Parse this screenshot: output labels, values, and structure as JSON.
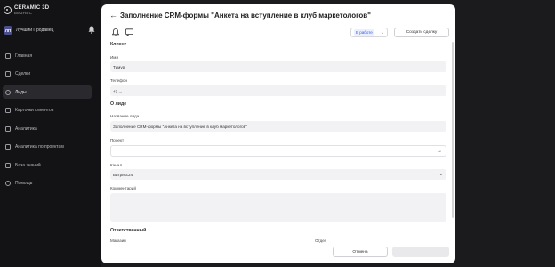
{
  "brand": {
    "name": "CERAMIC 3D",
    "sub": "БИЗНЕС"
  },
  "user": {
    "initials": "ЛП",
    "name": "Лучший Продавец"
  },
  "nav": [
    {
      "label": "Главная",
      "icon": "home-icon"
    },
    {
      "label": "Сделки",
      "icon": "deals-icon"
    },
    {
      "label": "Лиды",
      "icon": "leads-icon",
      "active": true
    },
    {
      "label": "Карточки клиентов",
      "icon": "cards-icon"
    },
    {
      "label": "Аналитика",
      "icon": "analytics-icon"
    },
    {
      "label": "Аналитика по проектам",
      "icon": "project-analytics-icon"
    },
    {
      "label": "База знаний",
      "icon": "book-icon"
    },
    {
      "label": "Помощь",
      "icon": "help-icon"
    }
  ],
  "modal": {
    "title": "Заполнение CRM-формы \"Анкета на вступление в клуб маркетологов\"",
    "status": "В работе",
    "create_deal": "Создать сделку",
    "client_section": "Клиент",
    "name_label": "Имя",
    "name_value": "Тимур",
    "phone_label": "Телефон",
    "phone_value": "+7 ...",
    "lead_section": "О лиде",
    "lead_name_label": "Название лида",
    "lead_name_value": "Заполнение CRM-формы \"Анкета на вступление в клуб маркетологов\"",
    "project_label": "Проект",
    "project_value": "",
    "channel_label": "Канал",
    "channel_value": "Битрикс24",
    "comment_label": "Комментарий",
    "comment_value": "",
    "responsible_section": "Ответственный",
    "store_label": "Магазин",
    "department_label": "Отдел",
    "cancel": "Отмена",
    "save": ""
  }
}
